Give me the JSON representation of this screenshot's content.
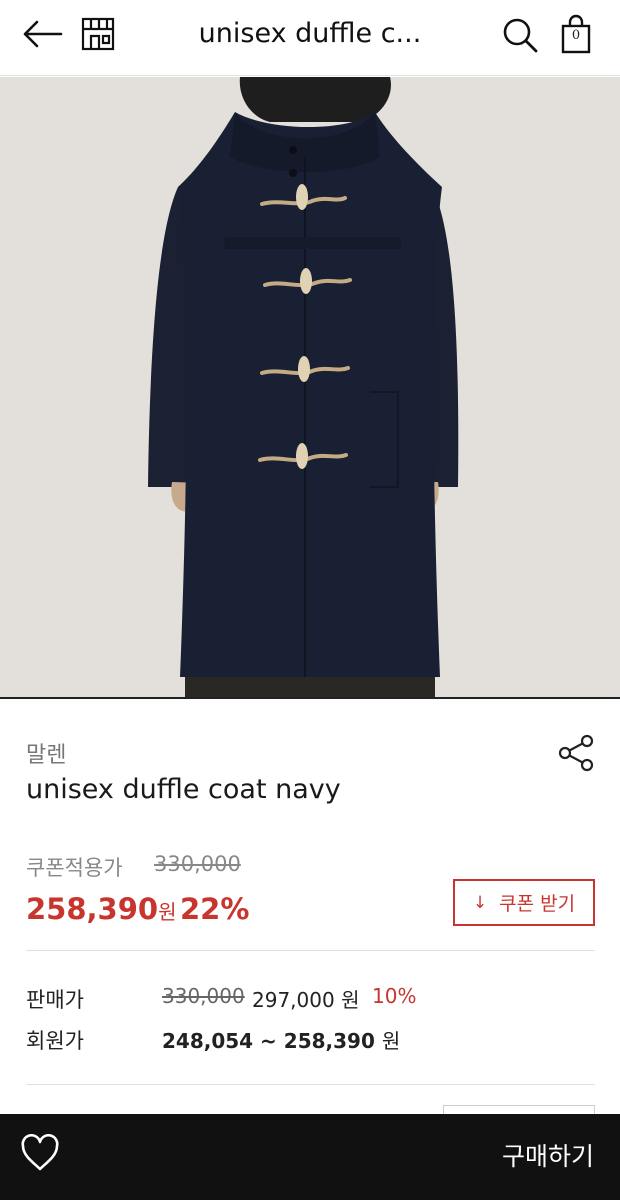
{
  "header": {
    "title": "unisex duffle c...",
    "cart_count": "0",
    "icons": [
      "back-arrow-icon",
      "shop-icon",
      "search-icon",
      "shopping-bag-icon"
    ]
  },
  "product": {
    "brand": "말렌",
    "name": "unisex duffle coat navy",
    "image_description": "navy duffle coat with toggles"
  },
  "pricing": {
    "coupon_label": "쿠폰적용가",
    "original_price": "330,000",
    "coupon_price": "258,390",
    "currency": "원",
    "coupon_discount": "22%",
    "coupon_button": "쿠폰 받기",
    "sale_label": "판매가",
    "sale_original": "330,000",
    "sale_price": "297,000 원",
    "sale_discount": "10%",
    "member_label": "회원가",
    "member_range": "248,054 ~ 258,390",
    "member_currency": "원"
  },
  "bottom_bar": {
    "buy_label": "구매하기",
    "icons": [
      "heart-icon"
    ]
  },
  "colors": {
    "accent": "#c8352f",
    "bar": "#111111",
    "coat": "#1a2033"
  }
}
